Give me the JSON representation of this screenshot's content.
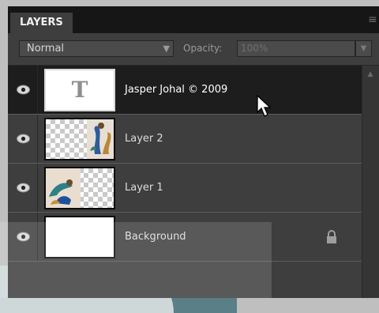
{
  "panel": {
    "tab_label": "LAYERS",
    "menu_icon": "panel-menu-icon"
  },
  "toolbar": {
    "blend_mode": "Normal",
    "blend_arrow": "▼",
    "opacity_label": "Opacity:",
    "opacity_value": "100%",
    "opacity_arrow": "▼"
  },
  "layers": [
    {
      "name": "Jasper Johal © 2009",
      "type": "text",
      "visible": true,
      "selected": true,
      "locked": false
    },
    {
      "name": "Layer 2",
      "type": "image",
      "visible": true,
      "selected": false,
      "locked": false
    },
    {
      "name": "Layer 1",
      "type": "image",
      "visible": true,
      "selected": false,
      "locked": false
    },
    {
      "name": "Background",
      "type": "background",
      "visible": true,
      "selected": false,
      "locked": true
    }
  ],
  "thumb_text_glyph": "T",
  "icons": {
    "visibility": "eye-icon",
    "lock": "lock-icon",
    "cursor": "mouse-cursor-icon",
    "scroll_up": "scroll-up-arrow"
  }
}
